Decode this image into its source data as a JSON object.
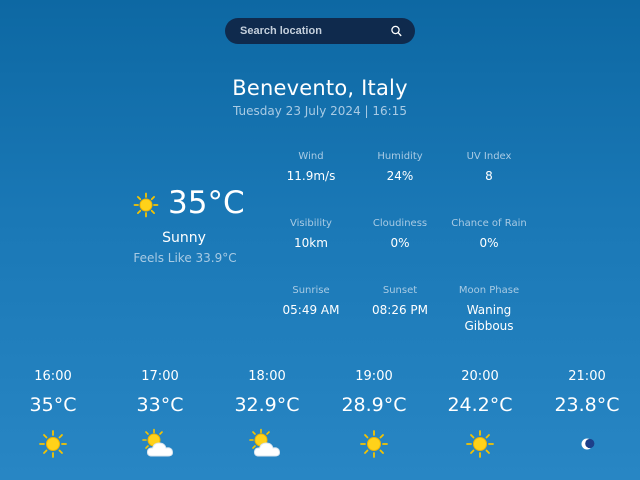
{
  "search": {
    "placeholder": "Search location",
    "icon": "search-icon"
  },
  "location": {
    "city": "Benevento, Italy",
    "datetime": "Tuesday 23 July 2024 | 16:15"
  },
  "current": {
    "temperature": "35°C",
    "condition": "Sunny",
    "feels_like": "Feels Like 33.9°C",
    "icon": "sun-icon"
  },
  "stats": [
    {
      "label": "Wind",
      "value": "11.9m/s"
    },
    {
      "label": "Humidity",
      "value": "24%"
    },
    {
      "label": "UV Index",
      "value": "8"
    },
    {
      "label": "Visibility",
      "value": "10km"
    },
    {
      "label": "Cloudiness",
      "value": "0%"
    },
    {
      "label": "Chance of Rain",
      "value": "0%"
    },
    {
      "label": "Sunrise",
      "value": "05:49 AM"
    },
    {
      "label": "Sunset",
      "value": "08:26 PM"
    },
    {
      "label": "Moon Phase",
      "value": "Waning\nGibbous"
    }
  ],
  "hourly": [
    {
      "time": "16:00",
      "temp": "35°C",
      "icon": "sun-icon"
    },
    {
      "time": "17:00",
      "temp": "33°C",
      "icon": "partly-cloudy-icon"
    },
    {
      "time": "18:00",
      "temp": "32.9°C",
      "icon": "partly-cloudy-icon"
    },
    {
      "time": "19:00",
      "temp": "28.9°C",
      "icon": "sun-icon"
    },
    {
      "time": "20:00",
      "temp": "24.2°C",
      "icon": "sun-icon"
    },
    {
      "time": "21:00",
      "temp": "23.8°C",
      "icon": "moon-icon"
    }
  ],
  "colors": {
    "sun": "#f5c400",
    "sun_center": "#ffd21a",
    "cloud": "#ffffff",
    "cloud_edge": "#d9e4ee",
    "moon": "#ffffff",
    "moon_shadow": "#1d3f8a"
  }
}
